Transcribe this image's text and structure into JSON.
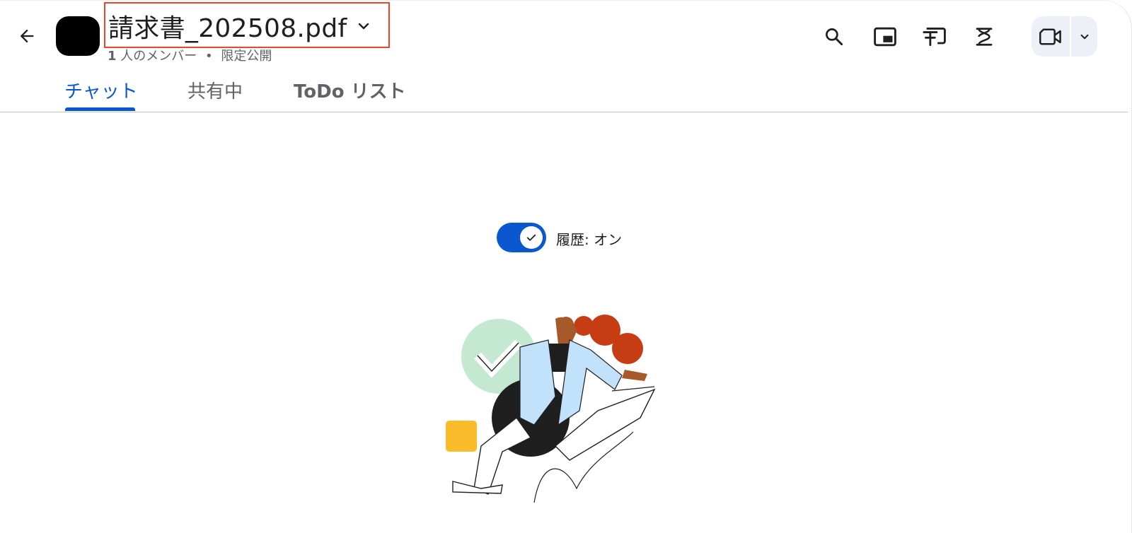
{
  "header": {
    "title": "請求書_202508.pdf",
    "member_count": "1",
    "member_label": "人のメンバー",
    "separator": "•",
    "visibility": "限定公開",
    "icons": {
      "back": "arrow-back-icon",
      "title_dropdown": "chevron-down-icon",
      "search": "search-icon",
      "pip": "picture-in-picture-icon",
      "pin": "pin-icon",
      "integrations": "hourglass-icon",
      "video": "video-camera-icon",
      "video_dropdown": "chevron-down-icon"
    }
  },
  "tabs": [
    {
      "label": "チャット",
      "active": true
    },
    {
      "label": "共有中",
      "active": false
    },
    {
      "label": "ToDo リスト",
      "active": false
    }
  ],
  "history": {
    "label": "履歴: オン",
    "enabled": true
  },
  "colors": {
    "accent": "#0b57d0",
    "highlight_border": "#e8472a",
    "avatar": "#000000",
    "illustration_green": "#c4e8d2",
    "illustration_orange": "#c63d14",
    "illustration_blue": "#c2e1fb",
    "illustration_yellow": "#fbbc2b"
  }
}
